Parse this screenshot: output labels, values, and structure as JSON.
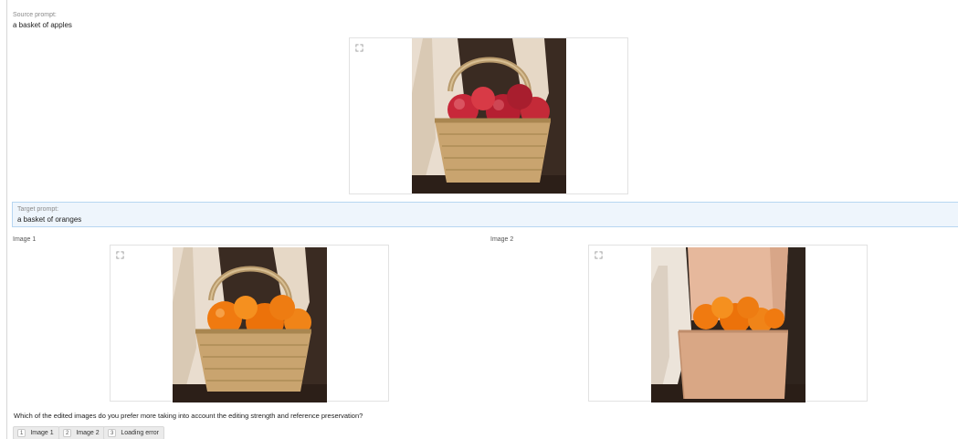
{
  "source": {
    "label": "Source prompt:",
    "text": "a basket of apples"
  },
  "target": {
    "label": "Target prompt:",
    "text": "a basket of oranges"
  },
  "images": [
    {
      "label": "Image 1"
    },
    {
      "label": "Image 2"
    }
  ],
  "question": "Which of the edited images do you prefer more taking into account the editing strength and reference preservation?",
  "answers": [
    {
      "key": "1",
      "label": "Image 1"
    },
    {
      "key": "2",
      "label": "Image 2"
    },
    {
      "key": "3",
      "label": "Loading error"
    }
  ],
  "colors": {
    "accent_border": "#b7d6f1",
    "accent_bg": "#eef5fc",
    "orange": "#f07a10",
    "apple_red": "#c8283a"
  },
  "icons": {
    "expand": "expand-icon"
  }
}
